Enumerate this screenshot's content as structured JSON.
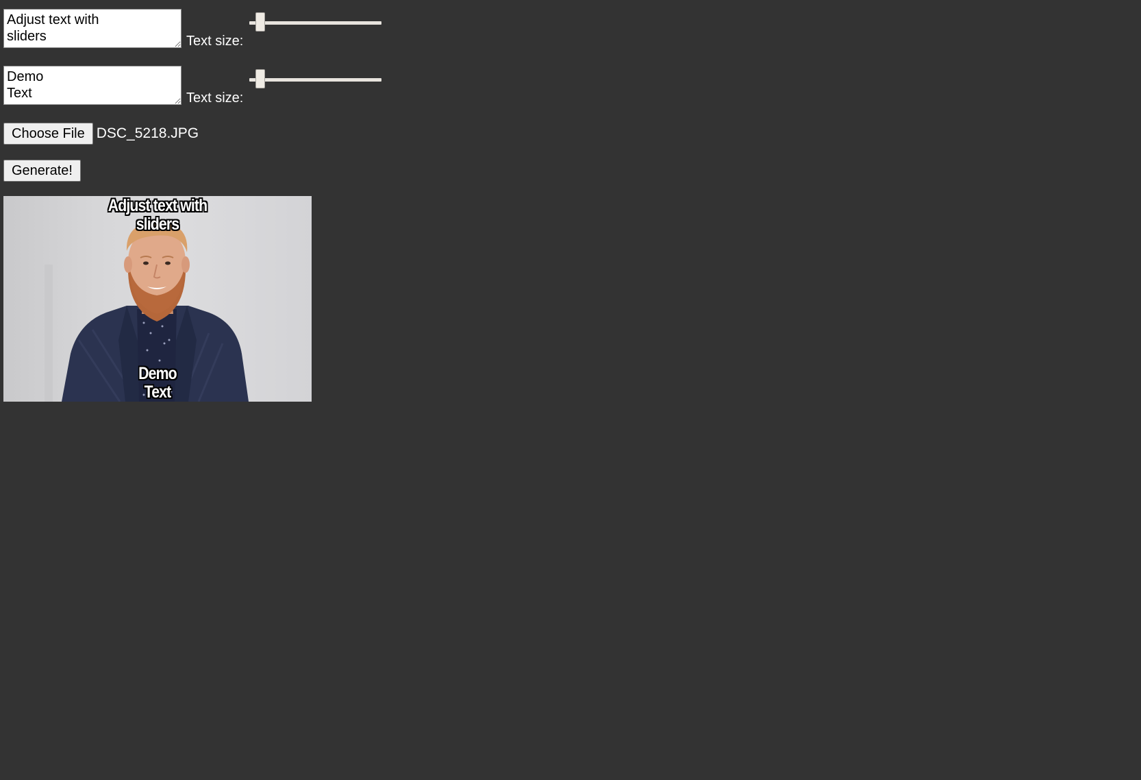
{
  "inputs": [
    {
      "caption_text": "Adjust text with\nsliders",
      "size_label": "Text size:",
      "size_value": 0.05
    },
    {
      "caption_text": "Demo\nText",
      "size_label": "Text size:",
      "size_value": 0.05
    }
  ],
  "file_input": {
    "button_label": "Choose File",
    "file_name": "DSC_5218.JPG"
  },
  "generate_label": "Generate!",
  "meme": {
    "top_text": "Adjust text with\nsliders",
    "bottom_text": "Demo\nText"
  },
  "colors": {
    "background": "#333333"
  }
}
